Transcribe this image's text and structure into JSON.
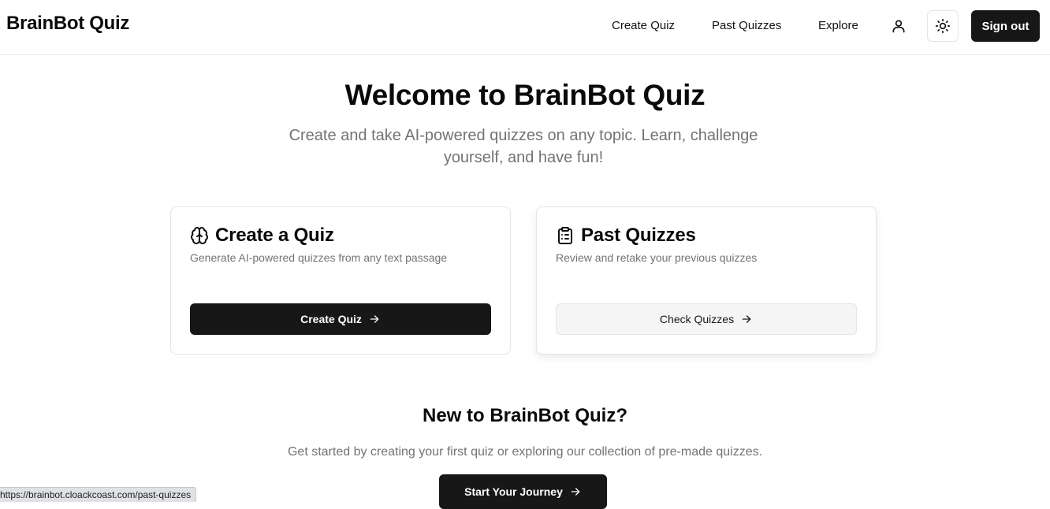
{
  "header": {
    "brand": "BrainBot Quiz",
    "nav": [
      "Create Quiz",
      "Past Quizzes",
      "Explore"
    ],
    "user_icon": "user-icon",
    "theme_icon": "sun-icon",
    "signout_label": "Sign out"
  },
  "hero": {
    "title": "Welcome to BrainBot Quiz",
    "subtitle": "Create and take AI-powered quizzes on any topic. Learn, challenge yourself, and have fun!"
  },
  "cards": [
    {
      "icon": "brain-icon",
      "title": "Create a Quiz",
      "description": "Generate AI-powered quizzes from any text passage",
      "button_label": "Create Quiz"
    },
    {
      "icon": "clipboard-list-icon",
      "title": "Past Quizzes",
      "description": "Review and retake your previous quizzes",
      "button_label": "Check Quizzes"
    }
  ],
  "onboarding": {
    "title": "New to BrainBot Quiz?",
    "subtitle": "Get started by creating your first quiz or exploring our collection of pre-made quizzes.",
    "button_label": "Start Your Journey"
  },
  "status_bar": {
    "url": "https://brainbot.cloackcoast.com/past-quizzes"
  },
  "colors": {
    "primary": "#171717",
    "muted_text": "#737373",
    "border": "#e5e5e5",
    "secondary_bg": "#f5f5f5"
  }
}
